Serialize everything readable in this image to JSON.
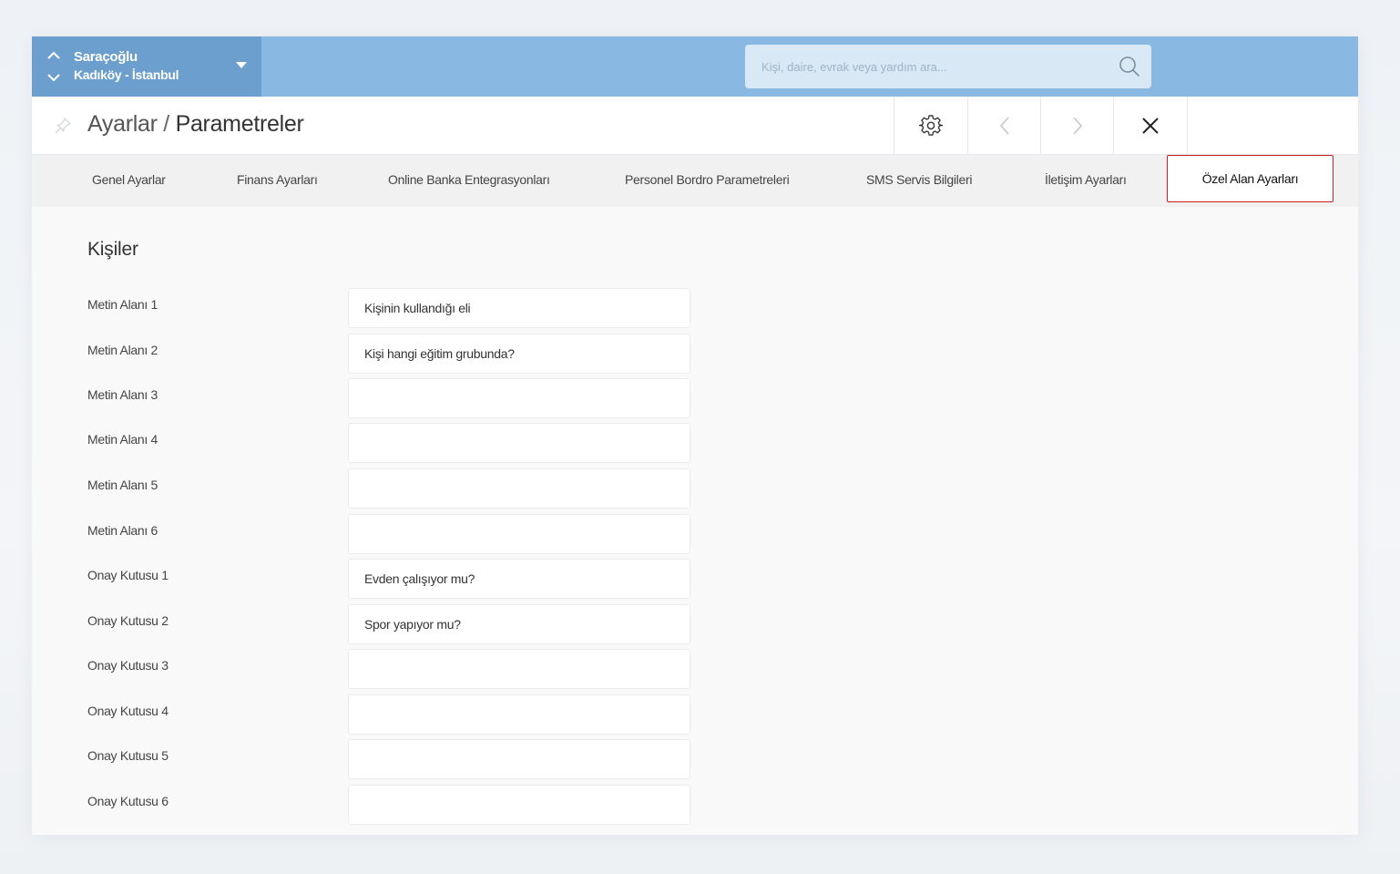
{
  "site": {
    "name": "Saraçoğlu",
    "location": "Kadıköy - İstanbul"
  },
  "search": {
    "placeholder": "Kişi, daire, evrak veya yardım ara..."
  },
  "breadcrumb": {
    "parent": "Ayarlar",
    "separator": " / ",
    "current": "Parametreler"
  },
  "tabs": [
    {
      "label": "Genel Ayarlar"
    },
    {
      "label": "Finans Ayarları"
    },
    {
      "label": "Online Banka Entegrasyonları"
    },
    {
      "label": "Personel Bordro Parametreleri"
    },
    {
      "label": "SMS Servis Bilgileri"
    },
    {
      "label": "İletişim Ayarları"
    },
    {
      "label": "Özel Alan Ayarları",
      "active": true
    }
  ],
  "section": {
    "title": "Kişiler"
  },
  "fields": [
    {
      "label": "Metin Alanı 1",
      "value": "Kişinin kullandığı eli"
    },
    {
      "label": "Metin Alanı 2",
      "value": "Kişi hangi eğitim grubunda?"
    },
    {
      "label": "Metin Alanı 3",
      "value": ""
    },
    {
      "label": "Metin Alanı 4",
      "value": ""
    },
    {
      "label": "Metin Alanı 5",
      "value": ""
    },
    {
      "label": "Metin Alanı 6",
      "value": ""
    },
    {
      "label": "Onay Kutusu 1",
      "value": "Evden çalışıyor mu?"
    },
    {
      "label": "Onay Kutusu 2",
      "value": "Spor yapıyor mu?"
    },
    {
      "label": "Onay Kutusu 3",
      "value": ""
    },
    {
      "label": "Onay Kutusu 4",
      "value": ""
    },
    {
      "label": "Onay Kutusu 5",
      "value": ""
    },
    {
      "label": "Onay Kutusu 6",
      "value": ""
    }
  ],
  "colors": {
    "topbar": "#89b9e3",
    "site_switch": "#6c9fcd",
    "active_tab_border": "#c81e2c"
  },
  "icons": [
    "chevron-up-icon",
    "chevron-down-icon",
    "caret-down-icon",
    "search-icon",
    "pin-icon",
    "gear-icon",
    "chevron-left-icon",
    "chevron-right-icon",
    "close-icon"
  ]
}
